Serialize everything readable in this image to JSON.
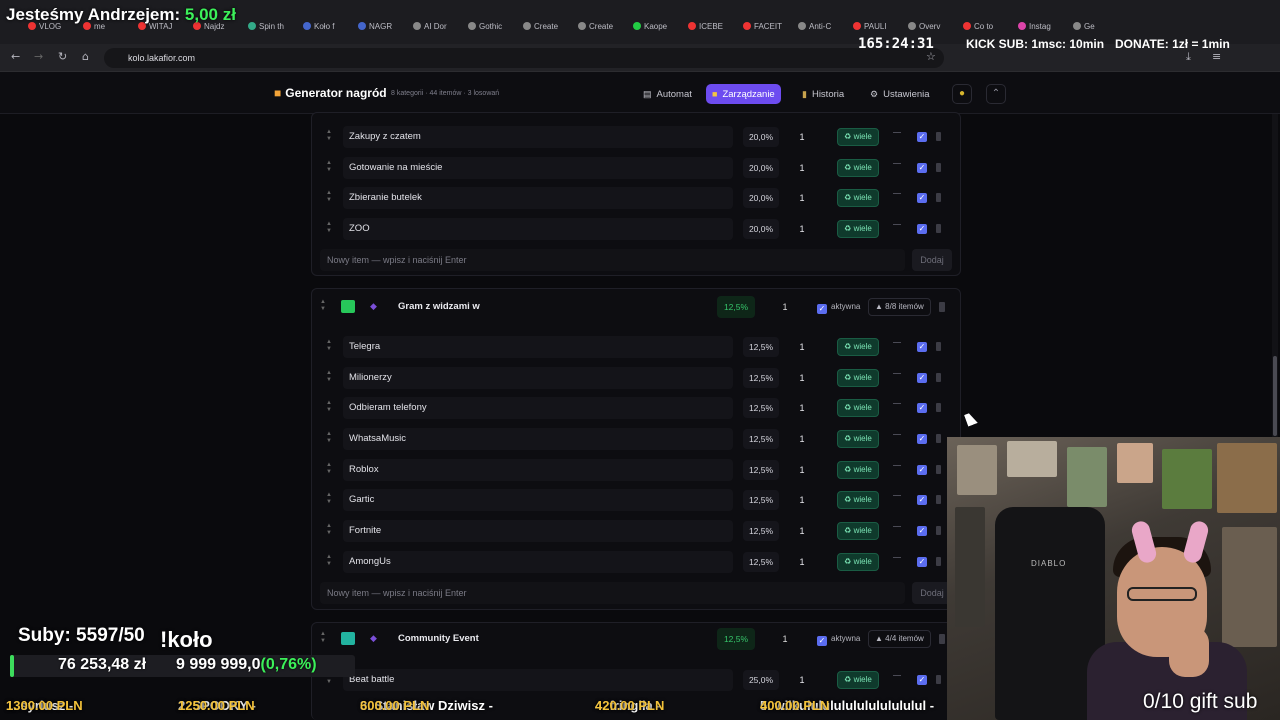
{
  "overlay": {
    "title_prefix": "Jesteśmy Andrzejem: ",
    "title_amount": "5,00 zł",
    "timer": "165:24:31",
    "kick": "KICK SUB: 1msc: 10min",
    "donate": "DONATE: 1zł = 1min",
    "subs": "Suby: 5597/50",
    "kolo": "!koło",
    "money": "76 253,48 zł",
    "goal": "9 999 999,0",
    "goal_pct": "(0,76%)",
    "goal_progress_pct": 0.76,
    "gift_sub": "0/10 gift sub",
    "ticker": [
      {
        "rank": "1. syriusz - ",
        "amount": "1300.00 PLN"
      },
      {
        "rank": "2. SPOOKY - ",
        "amount": "1250.00 PLN"
      },
      {
        "rank": "3. Stanisław Dziwisz - ",
        "amount": "600.00 PLN"
      },
      {
        "rank": "4. fringila - ",
        "amount": "420.00 PLN"
      },
      {
        "rank": "5. wilkululululululululululul - ",
        "amount": "400.00 PLN"
      }
    ]
  },
  "browser": {
    "url": "kolo.lakafior.com",
    "tabs": [
      "VLOG",
      "me",
      "WITAJ",
      "Najdz",
      "Spin th",
      "Koło f",
      "NAGR",
      "AI Dor",
      "Gothic",
      "Create",
      "Create",
      "Kaope",
      "ICEBE",
      "FACEIT",
      "Anti-C",
      "PAULI",
      "Overv",
      "Co to",
      "Instag",
      "Ge"
    ]
  },
  "app": {
    "title": "Generator nagród",
    "subtitle": "8 kategorii · 44 itemów · 3 losowań",
    "nav": [
      {
        "label": "Automat",
        "icon": "slot-machine-icon"
      },
      {
        "label": "Zarządzanie",
        "icon": "folder-icon"
      },
      {
        "label": "Historia",
        "icon": "history-icon"
      },
      {
        "label": "Ustawienia",
        "icon": "gear-icon"
      }
    ]
  },
  "common": {
    "wiele": "wiele",
    "new_placeholder": "Nowy item — wpisz i naciśnij Enter",
    "dodaj": "Dodaj",
    "aktywna": "aktywna",
    "check": "✓"
  },
  "group1": {
    "items": [
      {
        "name": "Zakupy z czatem",
        "pct": "20,0%",
        "qty": "1"
      },
      {
        "name": "Gotowanie na mieście",
        "pct": "20,0%",
        "qty": "1"
      },
      {
        "name": "Zbieranie butelek",
        "pct": "20,0%",
        "qty": "1"
      },
      {
        "name": "ZOO",
        "pct": "20,0%",
        "qty": "1"
      }
    ]
  },
  "group2": {
    "name": "Gram z widzami w",
    "pct": "12,5%",
    "qty": "1",
    "count": "▲ 8/8 itemów",
    "color": "#27c75a",
    "items": [
      {
        "name": "Telegra",
        "pct": "12,5%",
        "qty": "1"
      },
      {
        "name": "Milionerzy",
        "pct": "12,5%",
        "qty": "1"
      },
      {
        "name": "Odbieram telefony",
        "pct": "12,5%",
        "qty": "1"
      },
      {
        "name": "WhatsaMusic",
        "pct": "12,5%",
        "qty": "1"
      },
      {
        "name": "Roblox",
        "pct": "12,5%",
        "qty": "1"
      },
      {
        "name": "Gartic",
        "pct": "12,5%",
        "qty": "1"
      },
      {
        "name": "Fortnite",
        "pct": "12,5%",
        "qty": "1"
      },
      {
        "name": "AmongUs",
        "pct": "12,5%",
        "qty": "1"
      }
    ]
  },
  "group3": {
    "name": "Community Event",
    "pct": "12,5%",
    "qty": "1",
    "count": "▲ 4/4 itemów",
    "color": "#22b3a0",
    "items": [
      {
        "name": "Beat battle",
        "pct": "25,0%",
        "qty": "1"
      }
    ]
  }
}
